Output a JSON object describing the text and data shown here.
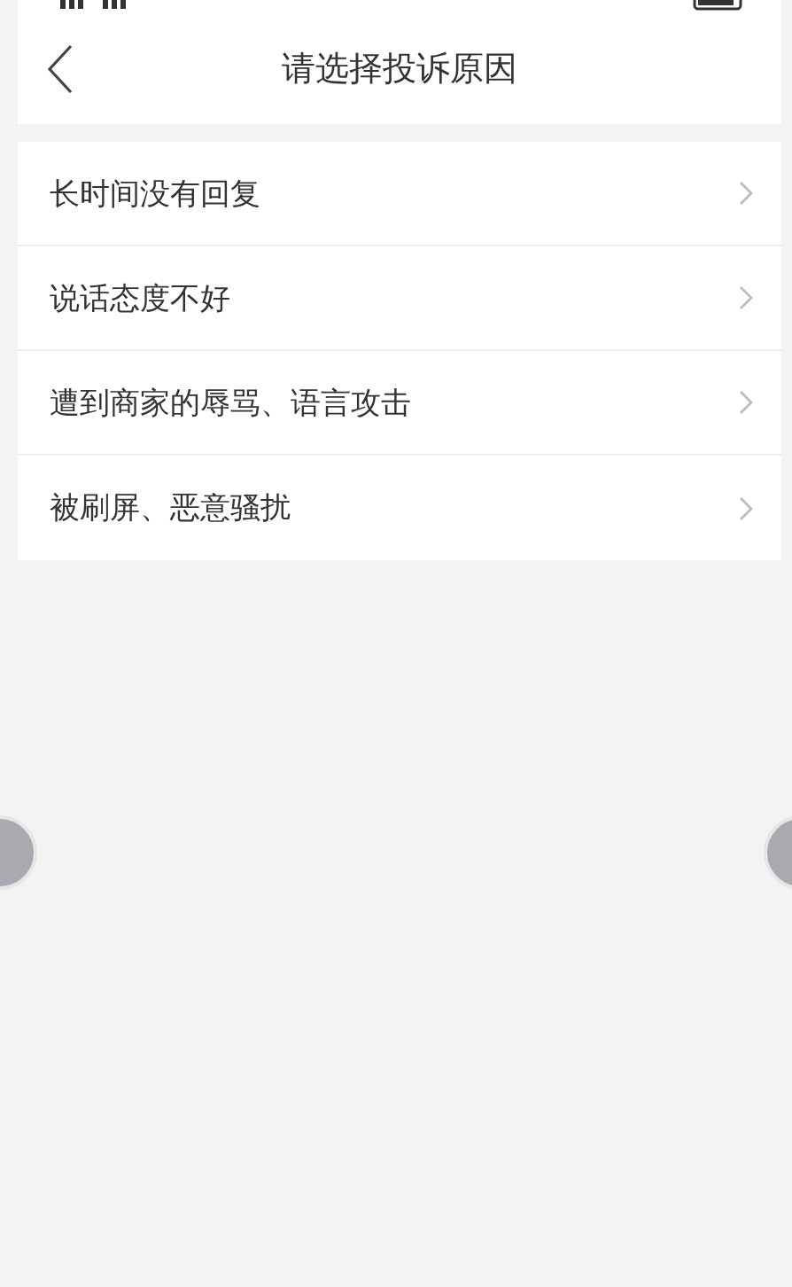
{
  "header": {
    "title": "请选择投诉原因"
  },
  "reasons": [
    {
      "label": "长时间没有回复"
    },
    {
      "label": "说话态度不好"
    },
    {
      "label": "遭到商家的辱骂、语言攻击"
    },
    {
      "label": "被刷屏、恶意骚扰"
    }
  ]
}
